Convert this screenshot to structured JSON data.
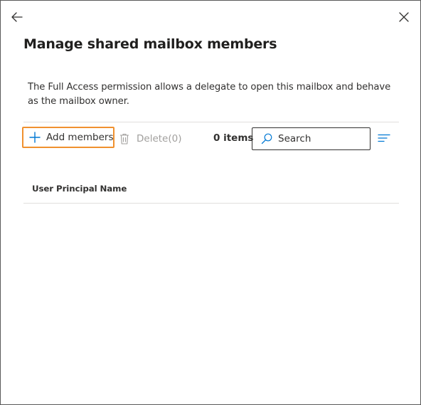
{
  "panel": {
    "title": "Manage shared mailbox members",
    "description": "The Full Access permission allows a delegate to open this mailbox and behave as the mailbox owner."
  },
  "nav": {
    "back_icon": "arrow-left-icon",
    "close_icon": "close-icon"
  },
  "toolbar": {
    "add_label": "Add members",
    "add_icon": "plus-icon",
    "delete_label": "Delete(0)",
    "delete_icon": "trash-icon",
    "item_count": "0 items",
    "search_placeholder": "Search",
    "search_icon": "search-icon",
    "filter_icon": "filter-lines-icon"
  },
  "table": {
    "columns": [
      "User Principal Name"
    ],
    "rows": []
  },
  "colors": {
    "accent": "#0078d4",
    "highlight": "#f0912f",
    "text": "#323130",
    "disabled": "#a19f9d"
  }
}
